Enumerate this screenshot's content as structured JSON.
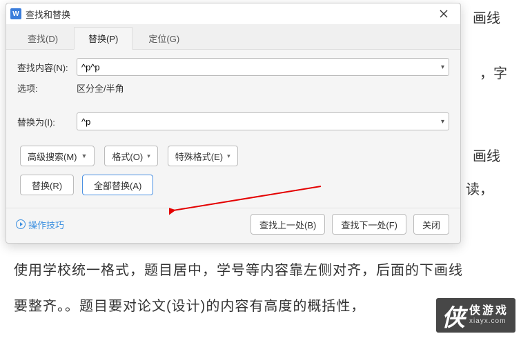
{
  "background": {
    "line1": "使用学校统一格式，题目居中，学号等内容靠左侧对齐，后面的下画线",
    "line2": "要整齐。。题目要对论文(设计)的内容有高度的概括性，",
    "frag_top": "画线",
    "frag_r2": "，字",
    "frag_r3": "画线",
    "frag_r4": "读，"
  },
  "dialog": {
    "title": "查找和替换",
    "tabs": [
      {
        "label": "查找(D)"
      },
      {
        "label": "替换(P)"
      },
      {
        "label": "定位(G)"
      }
    ],
    "find_label": "查找内容(N):",
    "find_value": "^p^p",
    "options_label": "选项:",
    "options_value": "区分全/半角",
    "replace_label": "替换为(I):",
    "replace_value": "^p",
    "adv_search": "高级搜索(M)",
    "format_btn": "格式(O)",
    "special_btn": "特殊格式(E)",
    "replace_btn": "替换(R)",
    "replace_all_btn": "全部替换(A)",
    "tips": "操作技巧",
    "find_prev": "查找上一处(B)",
    "find_next": "查找下一处(F)",
    "close": "关闭"
  },
  "watermark": {
    "cn": "侠游戏",
    "en": "xiayx.com"
  }
}
